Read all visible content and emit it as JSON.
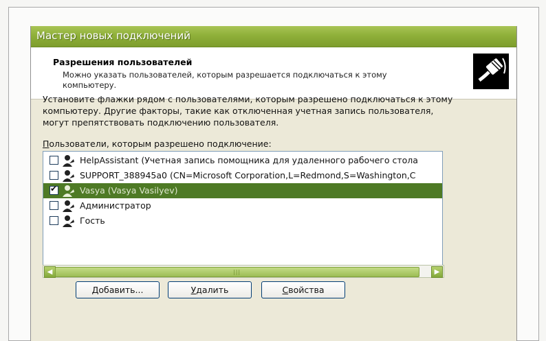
{
  "window": {
    "title": "Мастер новых подключений"
  },
  "header": {
    "title": "Разрешения пользователей",
    "subtitle": "Можно указать пользователей, которым разрешается подключаться к этому компьютеру.",
    "icon": "network-cable-icon"
  },
  "description": "Установите флажки рядом с пользователями, которым разрешено подключаться к этому компьютеру. Другие факторы, такие как отключенная учетная запись пользователя, могут препятствовать подключению пользователя.",
  "users_label": {
    "hotkey": "П",
    "rest": "ользователи, которым разрешено подключение:"
  },
  "users": [
    {
      "text": "HelpAssistant (Учетная запись помощника для удаленного рабочего стола",
      "checked": false,
      "selected": false,
      "check": ""
    },
    {
      "text": "SUPPORT_388945a0 (CN=Microsoft Corporation,L=Redmond,S=Washington,C",
      "checked": false,
      "selected": false,
      "check": ""
    },
    {
      "text": "Vasya (Vasya Vasilyev)",
      "checked": true,
      "selected": true,
      "check": "✔"
    },
    {
      "text": "Администратор",
      "checked": false,
      "selected": false,
      "check": ""
    },
    {
      "text": "Гость",
      "checked": false,
      "selected": false,
      "check": ""
    }
  ],
  "scrollbar": {
    "left_arrow": "◀",
    "right_arrow": "▶",
    "grip": "|||"
  },
  "buttons": {
    "add": {
      "hotkey": "Д",
      "rest": "обавить..."
    },
    "remove": {
      "hotkey": "У",
      "rest": "далить"
    },
    "properties": {
      "hotkey": "С",
      "rest": "войства"
    }
  },
  "colors": {
    "titlebar": "#8fb03a",
    "selection": "#4e7a25",
    "dialog": "#ece9d8"
  }
}
